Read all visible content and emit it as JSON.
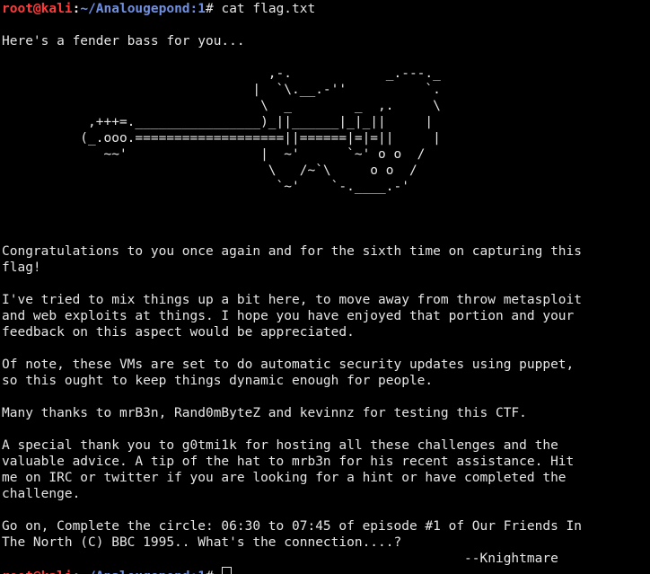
{
  "terminal": {
    "prompt": {
      "user_host": "root@kali",
      "separator": ":",
      "path": "~/Analougepond:1",
      "symbol": "# "
    },
    "command": "cat flag.txt",
    "intro": "Here's a fender bass for you...",
    "art_lines": [
      "                                  ,-.            _.---._",
      "                                |  `\\.__.-''          `.",
      "                                 \\  _        _  ,.     \\",
      "           ,+++=.________________)_||______|_|_||     |",
      "          (_.ooo.===================||======|=|=||     |",
      "             ~~'                 |  ~'      `~' o o  /",
      "                                  \\   /~`\\     o o  /",
      "                                   `~'    `-.____.-'"
    ],
    "message_lines": [
      "",
      "",
      "",
      "Congratulations to you once again and for the sixth time on capturing this",
      "flag!",
      "",
      "I've tried to mix things up a bit here, to move away from throw metasploit",
      "and web exploits at things. I hope you have enjoyed that portion and your",
      "feedback on this aspect would be appreciated.",
      "",
      "Of note, these VMs are set to do automatic security updates using puppet,",
      "so this ought to keep things dynamic enough for people.",
      "",
      "Many thanks to mrB3n, Rand0mByteZ and kevinnz for testing this CTF.",
      "",
      "A special thank you to g0tmi1k for hosting all these challenges and the",
      "valuable advice. A tip of the hat to mrb3n for his recent assistance. Hit",
      "me on IRC or twitter if you are looking for a hint or have completed the",
      "challenge.",
      "",
      "Go on, Complete the circle: 06:30 to 07:45 of episode #1 of Our Friends In",
      "The North (C) BBC 1995.. What's the connection....?",
      "                                                           --Knightmare"
    ],
    "colors": {
      "background": "#000000",
      "foreground": "#e6e6e6",
      "user_host": "#ff3b3b",
      "path": "#6f8fe0"
    }
  }
}
